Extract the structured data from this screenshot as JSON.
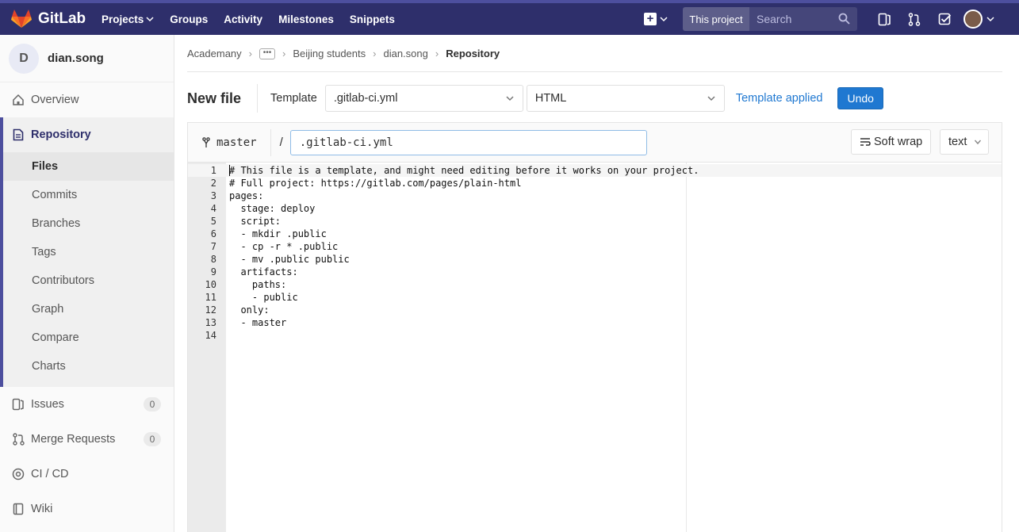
{
  "nav": {
    "brand": "GitLab",
    "links": [
      "Projects",
      "Groups",
      "Activity",
      "Milestones",
      "Snippets"
    ],
    "search_scope": "This project",
    "search_placeholder": "Search"
  },
  "sidebar": {
    "avatar_letter": "D",
    "project_name": "dian.song",
    "overview": "Overview",
    "repository": "Repository",
    "repo_sub": [
      "Files",
      "Commits",
      "Branches",
      "Tags",
      "Contributors",
      "Graph",
      "Compare",
      "Charts"
    ],
    "issues": "Issues",
    "issues_count": "0",
    "merge_requests": "Merge Requests",
    "mr_count": "0",
    "cicd": "CI / CD",
    "wiki": "Wiki"
  },
  "breadcrumb": {
    "items": [
      "Academany",
      "Beijing students",
      "dian.song"
    ],
    "current": "Repository"
  },
  "file_header": {
    "title": "New file",
    "template_label": "Template",
    "template_value": ".gitlab-ci.yml",
    "type_value": "HTML",
    "applied_text": "Template applied",
    "undo_label": "Undo"
  },
  "editor": {
    "branch": "master",
    "slash": "/",
    "filename": ".gitlab-ci.yml",
    "soft_wrap_label": "Soft wrap",
    "mode_value": "text",
    "lines": [
      "# This file is a template, and might need editing before it works on your project.",
      "# Full project: https://gitlab.com/pages/plain-html",
      "pages:",
      "  stage: deploy",
      "  script:",
      "  - mkdir .public",
      "  - cp -r * .public",
      "  - mv .public public",
      "  artifacts:",
      "    paths:",
      "    - public",
      "  only:",
      "  - master",
      ""
    ]
  }
}
